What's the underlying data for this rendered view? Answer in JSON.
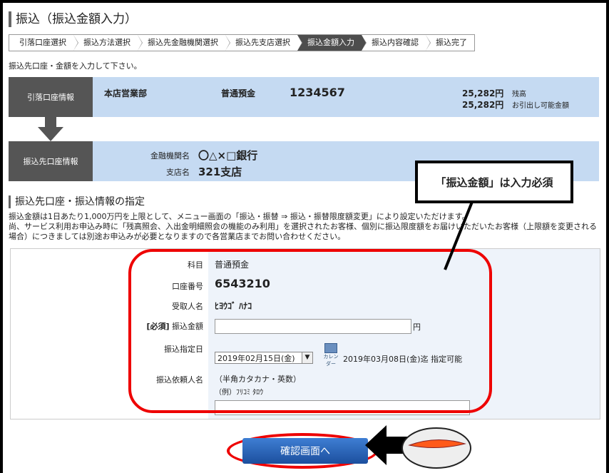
{
  "page_title": "振込（振込金額入力）",
  "steps": [
    {
      "label": "引落口座選択",
      "active": false
    },
    {
      "label": "振込方法選択",
      "active": false
    },
    {
      "label": "振込先金融機関選択",
      "active": false
    },
    {
      "label": "振込先支店選択",
      "active": false
    },
    {
      "label": "振込金額入力",
      "active": true
    },
    {
      "label": "振込内容確認",
      "active": false
    },
    {
      "label": "振込完了",
      "active": false
    }
  ],
  "instruction": "振込先口座・金額を入力して下さい。",
  "source_account": {
    "label": "引落口座情報",
    "branch": "本店営業部",
    "type": "普通預金",
    "number": "1234567",
    "balance_amount": "25,282円",
    "balance_label": "残高",
    "available_amount": "25,282円",
    "available_label": "お引出し可能金額"
  },
  "dest_account": {
    "label": "振込先口座情報",
    "bank_label": "金融機関名",
    "bank_value": "〇△×□銀行",
    "branch_label": "支店名",
    "branch_value": "321支店"
  },
  "section_title": "振込先口座・振込情報の指定",
  "notes": [
    "振込金額は1日あたり1,000万円を上限として、メニュー画面の「振込・振替 ⇒ 振込・振替限度額変更」により設定いただけます。",
    "尚、サービス利用お申込み時に「残高照会、入出金明細照会の機能のみ利用」を選択されたお客様、個別に振込限度額をお届けいただいたお客様（上限額を変更される場合）につきましては別途お申込みが必要となりますので各営業店までお問い合わせください。"
  ],
  "form": {
    "subject_label": "科目",
    "subject_value": "普通預金",
    "account_label": "口座番号",
    "account_value": "6543210",
    "recipient_label": "受取人名",
    "recipient_value": "ﾋﾖｳｺﾞ ﾊﾅｺ",
    "amount_required": "[必須]",
    "amount_label": "振込金額",
    "amount_value": "",
    "amount_unit": "円",
    "date_label": "振込指定日",
    "date_selected": "2019年02月15日(金)",
    "calendar_label": "カレンダー",
    "date_note": "2019年03月08日(金)迄 指定可能",
    "requester_label": "振込依頼人名",
    "requester_hint": "（半角カタカナ・英数）",
    "requester_example": "（例）ﾌﾘｺﾐ ﾀﾛｳ",
    "requester_value": ""
  },
  "callout": "「振込金額」は入力必須",
  "confirm_button": "確認画面へ",
  "colors": {
    "band": "#c5daf2",
    "label_bg": "#555555",
    "highlight": "#e00000",
    "button": "#1c4f9e"
  }
}
